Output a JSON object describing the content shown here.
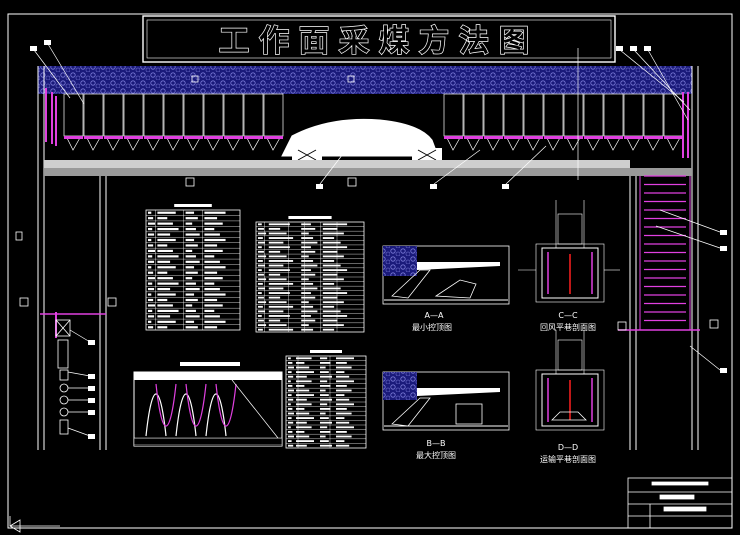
{
  "title": "工作面采煤方法图",
  "sections": [
    {
      "code": "A—A",
      "caption": "最小控顶图"
    },
    {
      "code": "B—B",
      "caption": "最大控顶图"
    },
    {
      "code": "C—C",
      "caption": "回风平巷剖面图"
    },
    {
      "code": "D—D",
      "caption": "运输平巷剖面图"
    }
  ],
  "colors": {
    "background": "#000000",
    "line": "#ffffff",
    "magenta": "#e040e0",
    "blue": "#1a1a7a",
    "red": "#ff2020",
    "gray": "#cfcfcf"
  },
  "charts": {
    "cycle_diagram": {
      "type": "line",
      "cycles": 3
    }
  }
}
